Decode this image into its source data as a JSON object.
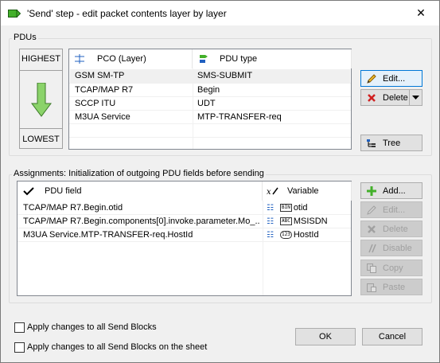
{
  "window": {
    "title": "'Send' step - edit packet contents layer by layer",
    "close_glyph": "✕"
  },
  "pdus": {
    "legend": "PDUs",
    "layers": {
      "highest": "HIGHEST",
      "lowest": "LOWEST"
    },
    "columns": [
      "PCO (Layer)",
      "PDU type"
    ],
    "rows": [
      {
        "pco": "GSM SM-TP",
        "type": "SMS-SUBMIT"
      },
      {
        "pco": "TCAP/MAP R7",
        "type": "Begin"
      },
      {
        "pco": "SCCP ITU",
        "type": "UDT"
      },
      {
        "pco": "M3UA Service",
        "type": "MTP-TRANSFER-req"
      }
    ],
    "buttons": {
      "edit": "Edit...",
      "delete": "Delete",
      "tree": "Tree"
    }
  },
  "assignments": {
    "legend": "Assignments: Initialization of outgoing PDU fields before sending",
    "columns": [
      "PDU field",
      "Variable"
    ],
    "rows": [
      {
        "field": "TCAP/MAP R7.Begin.otid",
        "var_type": "BIN",
        "variable": "otid"
      },
      {
        "field": "TCAP/MAP R7.Begin.components[0].invoke.parameter.Mo_...",
        "var_type": "ABC",
        "variable": "MSISDN"
      },
      {
        "field": "M3UA Service.MTP-TRANSFER-req.HostId",
        "var_type": "123",
        "variable": "HostId"
      }
    ],
    "buttons": {
      "add": "Add...",
      "edit": "Edit...",
      "delete": "Delete",
      "disable": "Disable",
      "copy": "Copy",
      "paste": "Paste"
    }
  },
  "options": {
    "apply_all": "Apply changes to all Send Blocks",
    "apply_sheet": "Apply changes to all Send Blocks on the sheet"
  },
  "dialog_buttons": {
    "ok": "OK",
    "cancel": "Cancel"
  },
  "colors": {
    "accent": "#0078d7",
    "selected_row": "#f0f0f0",
    "arrow_green": "#8bd36a"
  }
}
